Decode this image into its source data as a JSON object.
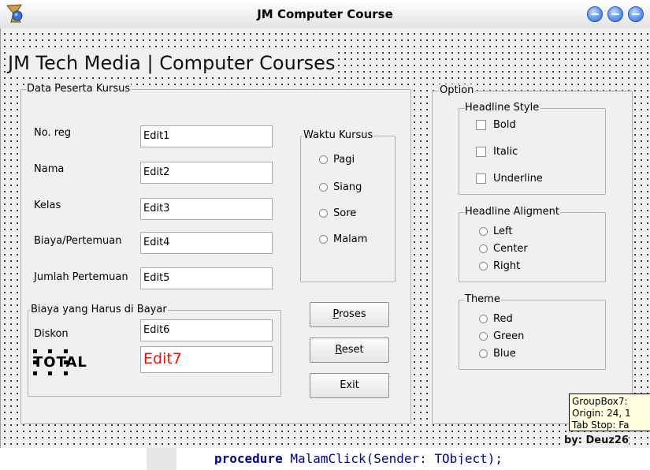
{
  "window": {
    "title": "JM Computer Course"
  },
  "heading": "JM Tech Media | Computer  Courses",
  "data_group": {
    "caption": "Data Peserta Kursus",
    "fields": [
      {
        "label": "No. reg",
        "value": "Edit1"
      },
      {
        "label": "Nama",
        "value": "Edit2"
      },
      {
        "label": "Kelas",
        "value": "Edit3"
      },
      {
        "label": "Biaya/Pertemuan",
        "value": "Edit4"
      },
      {
        "label": "Jumlah Pertemuan",
        "value": "Edit5"
      }
    ],
    "waktu": {
      "caption": "Waktu Kursus",
      "options": [
        "Pagi",
        "Siang",
        "Sore",
        "Malam"
      ]
    },
    "biaya": {
      "caption": "Biaya yang Harus di Bayar",
      "diskon_label": "Diskon",
      "diskon_value": "Edit6",
      "total_label": "TOTAL",
      "total_value": "Edit7"
    },
    "buttons": {
      "proses_hotkey": "P",
      "proses_rest": "roses",
      "reset_hotkey": "R",
      "reset_rest": "eset",
      "exit": "Exit"
    }
  },
  "option_group": {
    "caption": "Option",
    "headline_style": {
      "caption": "Headline Style",
      "options": [
        "Bold",
        "Italic",
        "Underline"
      ]
    },
    "headline_alignment": {
      "caption": "Headline Aligment",
      "options": [
        "Left",
        "Center",
        "Right"
      ]
    },
    "theme": {
      "caption": "Theme",
      "options": [
        "Red",
        "Green",
        "Blue"
      ]
    }
  },
  "tooltip": {
    "line1": "GroupBox7:",
    "line2": "Origin: 24, 1",
    "line3": "Tab Stop: Fa"
  },
  "byline": "by: Deuz26",
  "code": {
    "keyword": "procedure",
    "rest": " MalamClick(Sender: TObject);"
  },
  "colors": {
    "edit7_text": "#ee1111",
    "form_bg": "#f0f0f0",
    "tooltip_bg": "#ffffe1",
    "title_buttons": "#4a86e8"
  }
}
